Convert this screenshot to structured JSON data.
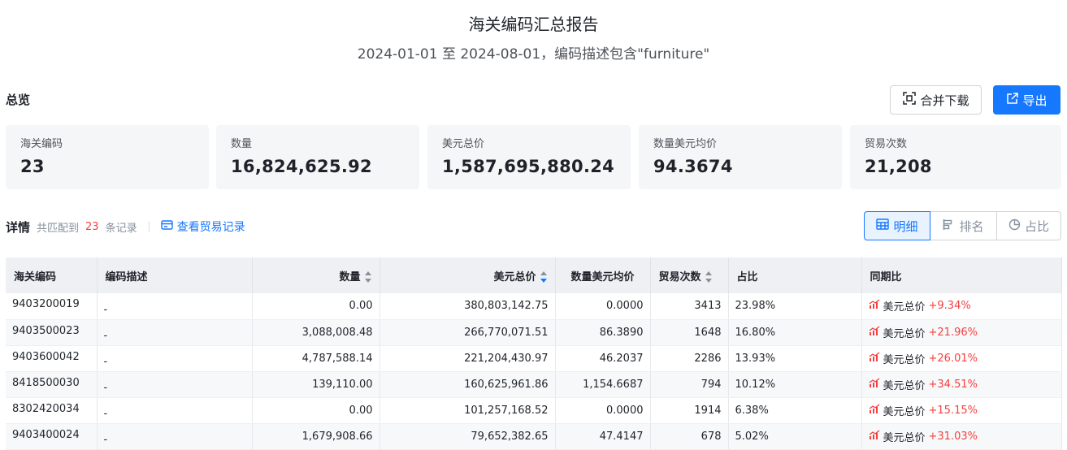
{
  "header": {
    "title": "海关编码汇总报告",
    "subtitle": "2024-01-01 至 2024-08-01，编码描述包含\"furniture\""
  },
  "overview": {
    "label": "总览",
    "merge_download": "合并下载",
    "export": "导出",
    "cards": [
      {
        "label": "海关编码",
        "value": "23"
      },
      {
        "label": "数量",
        "value": "16,824,625.92"
      },
      {
        "label": "美元总价",
        "value": "1,587,695,880.24"
      },
      {
        "label": "数量美元均价",
        "value": "94.3674"
      },
      {
        "label": "贸易次数",
        "value": "21,208"
      }
    ]
  },
  "detail": {
    "label": "详情",
    "matched_prefix": "共匹配到",
    "matched_count": "23",
    "matched_suffix": "条记录",
    "view_trades": "查看贸易记录",
    "views": [
      "明细",
      "排名",
      "占比"
    ]
  },
  "table": {
    "columns": [
      "海关编码",
      "编码描述",
      "数量",
      "美元总价",
      "数量美元均价",
      "贸易次数",
      "占比",
      "同期比"
    ],
    "yoy_prefix": "美元总价",
    "rows": [
      {
        "code": "9403200019",
        "desc": "-",
        "qty": "0.00",
        "usd": "380,803,142.75",
        "avg": "0.0000",
        "trades": "3413",
        "share": "23.98%",
        "yoy": "+9.34%"
      },
      {
        "code": "9403500023",
        "desc": "-",
        "qty": "3,088,008.48",
        "usd": "266,770,071.51",
        "avg": "86.3890",
        "trades": "1648",
        "share": "16.80%",
        "yoy": "+21.96%"
      },
      {
        "code": "9403600042",
        "desc": "-",
        "qty": "4,787,588.14",
        "usd": "221,204,430.97",
        "avg": "46.2037",
        "trades": "2286",
        "share": "13.93%",
        "yoy": "+26.01%"
      },
      {
        "code": "8418500030",
        "desc": "-",
        "qty": "139,110.00",
        "usd": "160,625,961.86",
        "avg": "1,154.6687",
        "trades": "794",
        "share": "10.12%",
        "yoy": "+34.51%"
      },
      {
        "code": "8302420034",
        "desc": "-",
        "qty": "0.00",
        "usd": "101,257,168.52",
        "avg": "0.0000",
        "trades": "1914",
        "share": "6.38%",
        "yoy": "+15.15%"
      },
      {
        "code": "9403400024",
        "desc": "-",
        "qty": "1,679,908.66",
        "usd": "79,652,382.65",
        "avg": "47.4147",
        "trades": "678",
        "share": "5.02%",
        "yoy": "+31.03%"
      }
    ]
  },
  "colors": {
    "accent": "#1677ff",
    "positive": "#f53f3f"
  }
}
